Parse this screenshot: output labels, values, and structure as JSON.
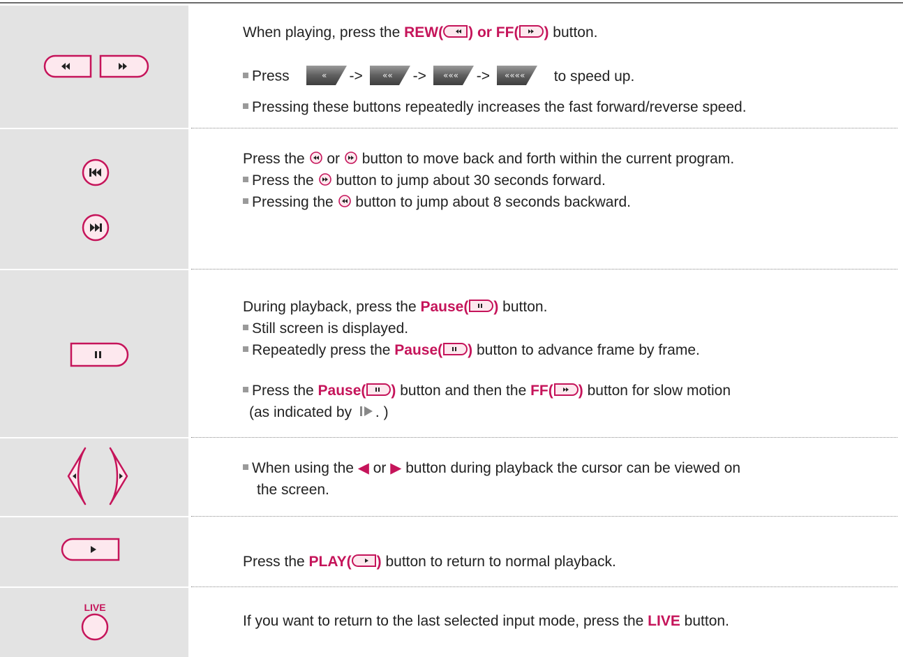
{
  "accent_color": "#c5145a",
  "rows": {
    "r1": {
      "line1_pre": "When playing, press the ",
      "line1_rew": "REW(",
      "line1_mid": ") or FF(",
      "line1_end": ")",
      "line1_post": " button.",
      "press": "Press",
      "arrow": "->",
      "speed_up": "to speed up.",
      "note": "Pressing these buttons repeatedly increases the fast forward/reverse speed."
    },
    "r2": {
      "line1_pre": "Press the ",
      "line1_or": " or ",
      "line1_post": " button to move back and forth within the current program.",
      "b1_pre": "Press the ",
      "b1_post": " button to jump about 30 seconds forward.",
      "b2_pre": "Pressing the ",
      "b2_post": " button to jump about 8 seconds backward."
    },
    "r3": {
      "line1_pre": "During playback, press the ",
      "pause": "Pause(",
      "paren_close": ")",
      "line1_post": " button.",
      "b1": "Still screen is displayed.",
      "b2_pre": "Repeatedly press the ",
      "b2_post": " button to advance frame by frame.",
      "b3_pre": "Press the ",
      "b3_mid": " button and then the ",
      "ff": "FF(",
      "b3_post": " button for slow motion",
      "b3_line2_pre": "(as indicated by ",
      "b3_line2_post": ". )"
    },
    "r4": {
      "line1_pre": "When using the ",
      "line1_or": " or ",
      "line1_post": " button during playback the cursor can be viewed on",
      "line2": "the screen."
    },
    "r5": {
      "pre": "Press the ",
      "play": "PLAY(",
      "paren_close": ")",
      "post": " button to return to normal playback."
    },
    "r6": {
      "live_icon_label": "LIVE",
      "pre": "If you want to return to the last selected input mode, press the ",
      "live": "LIVE",
      "post": " button."
    }
  }
}
